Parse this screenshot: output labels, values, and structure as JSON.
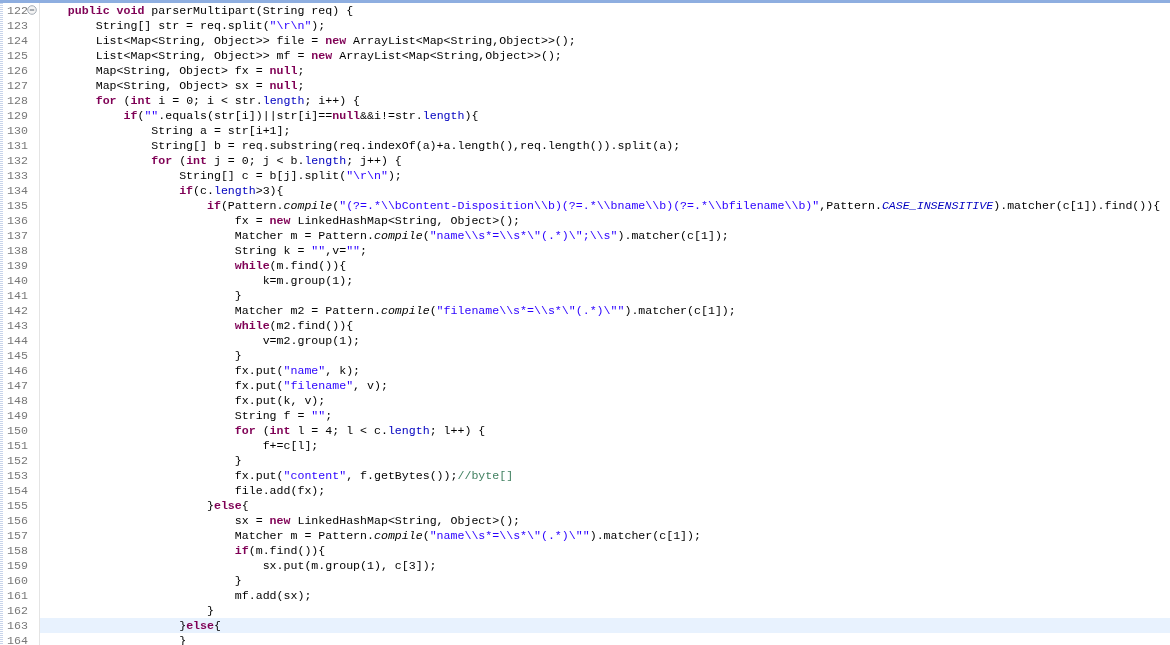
{
  "editor": {
    "lines": [
      {
        "number": "122",
        "collapsible": true,
        "current": false,
        "tokens": [
          {
            "kind": "keyword",
            "text": "    public"
          },
          {
            "kind": "keyword",
            "text": " void"
          },
          {
            "kind": "plain",
            "text": " parserMultipart(String req) {"
          }
        ]
      },
      {
        "number": "123",
        "collapsible": false,
        "current": false,
        "tokens": [
          {
            "kind": "plain",
            "text": "        String[] str = req.split("
          },
          {
            "kind": "string",
            "text": "\"\\r\\n\""
          },
          {
            "kind": "plain",
            "text": ");"
          }
        ]
      },
      {
        "number": "124",
        "collapsible": false,
        "current": false,
        "tokens": [
          {
            "kind": "plain",
            "text": "        List<Map<String, Object>> file = "
          },
          {
            "kind": "keyword",
            "text": "new"
          },
          {
            "kind": "plain",
            "text": " ArrayList<Map<String,Object>>();"
          }
        ]
      },
      {
        "number": "125",
        "collapsible": false,
        "current": false,
        "tokens": [
          {
            "kind": "plain",
            "text": "        List<Map<String, Object>> mf = "
          },
          {
            "kind": "keyword",
            "text": "new"
          },
          {
            "kind": "plain",
            "text": " ArrayList<Map<String,Object>>();"
          }
        ]
      },
      {
        "number": "126",
        "collapsible": false,
        "current": false,
        "tokens": [
          {
            "kind": "plain",
            "text": "        Map<String, Object> fx = "
          },
          {
            "kind": "keyword",
            "text": "null"
          },
          {
            "kind": "plain",
            "text": ";"
          }
        ]
      },
      {
        "number": "127",
        "collapsible": false,
        "current": false,
        "tokens": [
          {
            "kind": "plain",
            "text": "        Map<String, Object> sx = "
          },
          {
            "kind": "keyword",
            "text": "null"
          },
          {
            "kind": "plain",
            "text": ";"
          }
        ]
      },
      {
        "number": "128",
        "collapsible": false,
        "current": false,
        "tokens": [
          {
            "kind": "keyword",
            "text": "        for"
          },
          {
            "kind": "plain",
            "text": " ("
          },
          {
            "kind": "keyword",
            "text": "int"
          },
          {
            "kind": "plain",
            "text": " i = 0; i < str."
          },
          {
            "kind": "field",
            "text": "length"
          },
          {
            "kind": "plain",
            "text": "; i++) {"
          }
        ]
      },
      {
        "number": "129",
        "collapsible": false,
        "current": false,
        "tokens": [
          {
            "kind": "keyword",
            "text": "            if"
          },
          {
            "kind": "plain",
            "text": "("
          },
          {
            "kind": "string",
            "text": "\"\""
          },
          {
            "kind": "plain",
            "text": ".equals(str[i])||str[i]=="
          },
          {
            "kind": "keyword",
            "text": "null"
          },
          {
            "kind": "plain",
            "text": "&&i!=str."
          },
          {
            "kind": "field",
            "text": "length"
          },
          {
            "kind": "plain",
            "text": "){"
          }
        ]
      },
      {
        "number": "130",
        "collapsible": false,
        "current": false,
        "tokens": [
          {
            "kind": "plain",
            "text": "                String a = str[i+1];"
          }
        ]
      },
      {
        "number": "131",
        "collapsible": false,
        "current": false,
        "tokens": [
          {
            "kind": "plain",
            "text": "                String[] b = req.substring(req.indexOf(a)+a.length(),req.length()).split(a);"
          }
        ]
      },
      {
        "number": "132",
        "collapsible": false,
        "current": false,
        "tokens": [
          {
            "kind": "keyword",
            "text": "                for"
          },
          {
            "kind": "plain",
            "text": " ("
          },
          {
            "kind": "keyword",
            "text": "int"
          },
          {
            "kind": "plain",
            "text": " j = 0; j < b."
          },
          {
            "kind": "field",
            "text": "length"
          },
          {
            "kind": "plain",
            "text": "; j++) {"
          }
        ]
      },
      {
        "number": "133",
        "collapsible": false,
        "current": false,
        "tokens": [
          {
            "kind": "plain",
            "text": "                    String[] c = b[j].split("
          },
          {
            "kind": "string",
            "text": "\"\\r\\n\""
          },
          {
            "kind": "plain",
            "text": ");"
          }
        ]
      },
      {
        "number": "134",
        "collapsible": false,
        "current": false,
        "tokens": [
          {
            "kind": "keyword",
            "text": "                    if"
          },
          {
            "kind": "plain",
            "text": "(c."
          },
          {
            "kind": "field",
            "text": "length"
          },
          {
            "kind": "plain",
            "text": ">3){"
          }
        ]
      },
      {
        "number": "135",
        "collapsible": false,
        "current": false,
        "tokens": [
          {
            "kind": "keyword",
            "text": "                        if"
          },
          {
            "kind": "plain",
            "text": "(Pattern."
          },
          {
            "kind": "static",
            "text": "compile"
          },
          {
            "kind": "plain",
            "text": "("
          },
          {
            "kind": "string",
            "text": "\"(?=.*\\\\bContent-Disposition\\\\b)(?=.*\\\\bname\\\\b)(?=.*\\\\bfilename\\\\b)\""
          },
          {
            "kind": "plain",
            "text": ",Pattern."
          },
          {
            "kind": "static_field",
            "text": "CASE_INSENSITIVE"
          },
          {
            "kind": "plain",
            "text": ").matcher(c[1]).find()){"
          }
        ]
      },
      {
        "number": "136",
        "collapsible": false,
        "current": false,
        "tokens": [
          {
            "kind": "plain",
            "text": "                            fx = "
          },
          {
            "kind": "keyword",
            "text": "new"
          },
          {
            "kind": "plain",
            "text": " LinkedHashMap<String, Object>();"
          }
        ]
      },
      {
        "number": "137",
        "collapsible": false,
        "current": false,
        "tokens": [
          {
            "kind": "plain",
            "text": "                            Matcher m = Pattern."
          },
          {
            "kind": "static",
            "text": "compile"
          },
          {
            "kind": "plain",
            "text": "("
          },
          {
            "kind": "string",
            "text": "\"name\\\\s*=\\\\s*\\\"(.*)\\\";\\\\s\""
          },
          {
            "kind": "plain",
            "text": ").matcher(c[1]);"
          }
        ]
      },
      {
        "number": "138",
        "collapsible": false,
        "current": false,
        "tokens": [
          {
            "kind": "plain",
            "text": "                            String k = "
          },
          {
            "kind": "string",
            "text": "\"\""
          },
          {
            "kind": "plain",
            "text": ",v="
          },
          {
            "kind": "string",
            "text": "\"\""
          },
          {
            "kind": "plain",
            "text": ";"
          }
        ]
      },
      {
        "number": "139",
        "collapsible": false,
        "current": false,
        "tokens": [
          {
            "kind": "keyword",
            "text": "                            while"
          },
          {
            "kind": "plain",
            "text": "(m.find()){"
          }
        ]
      },
      {
        "number": "140",
        "collapsible": false,
        "current": false,
        "tokens": [
          {
            "kind": "plain",
            "text": "                                k=m.group(1);"
          }
        ]
      },
      {
        "number": "141",
        "collapsible": false,
        "current": false,
        "tokens": [
          {
            "kind": "plain",
            "text": "                            }"
          }
        ]
      },
      {
        "number": "142",
        "collapsible": false,
        "current": false,
        "tokens": [
          {
            "kind": "plain",
            "text": "                            Matcher m2 = Pattern."
          },
          {
            "kind": "static",
            "text": "compile"
          },
          {
            "kind": "plain",
            "text": "("
          },
          {
            "kind": "string",
            "text": "\"filename\\\\s*=\\\\s*\\\"(.*)\\\"\""
          },
          {
            "kind": "plain",
            "text": ").matcher(c[1]);"
          }
        ]
      },
      {
        "number": "143",
        "collapsible": false,
        "current": false,
        "tokens": [
          {
            "kind": "keyword",
            "text": "                            while"
          },
          {
            "kind": "plain",
            "text": "(m2.find()){"
          }
        ]
      },
      {
        "number": "144",
        "collapsible": false,
        "current": false,
        "tokens": [
          {
            "kind": "plain",
            "text": "                                v=m2.group(1);"
          }
        ]
      },
      {
        "number": "145",
        "collapsible": false,
        "current": false,
        "tokens": [
          {
            "kind": "plain",
            "text": "                            }"
          }
        ]
      },
      {
        "number": "146",
        "collapsible": false,
        "current": false,
        "tokens": [
          {
            "kind": "plain",
            "text": "                            fx.put("
          },
          {
            "kind": "string",
            "text": "\"name\""
          },
          {
            "kind": "plain",
            "text": ", k);"
          }
        ]
      },
      {
        "number": "147",
        "collapsible": false,
        "current": false,
        "tokens": [
          {
            "kind": "plain",
            "text": "                            fx.put("
          },
          {
            "kind": "string",
            "text": "\"filename\""
          },
          {
            "kind": "plain",
            "text": ", v);"
          }
        ]
      },
      {
        "number": "148",
        "collapsible": false,
        "current": false,
        "tokens": [
          {
            "kind": "plain",
            "text": "                            fx.put(k, v);"
          }
        ]
      },
      {
        "number": "149",
        "collapsible": false,
        "current": false,
        "tokens": [
          {
            "kind": "plain",
            "text": "                            String f = "
          },
          {
            "kind": "string",
            "text": "\"\""
          },
          {
            "kind": "plain",
            "text": ";"
          }
        ]
      },
      {
        "number": "150",
        "collapsible": false,
        "current": false,
        "tokens": [
          {
            "kind": "keyword",
            "text": "                            for"
          },
          {
            "kind": "plain",
            "text": " ("
          },
          {
            "kind": "keyword",
            "text": "int"
          },
          {
            "kind": "plain",
            "text": " l = 4; l < c."
          },
          {
            "kind": "field",
            "text": "length"
          },
          {
            "kind": "plain",
            "text": "; l++) {"
          }
        ]
      },
      {
        "number": "151",
        "collapsible": false,
        "current": false,
        "tokens": [
          {
            "kind": "plain",
            "text": "                                f+=c[l];"
          }
        ]
      },
      {
        "number": "152",
        "collapsible": false,
        "current": false,
        "tokens": [
          {
            "kind": "plain",
            "text": "                            }"
          }
        ]
      },
      {
        "number": "153",
        "collapsible": false,
        "current": false,
        "tokens": [
          {
            "kind": "plain",
            "text": "                            fx.put("
          },
          {
            "kind": "string",
            "text": "\"content\""
          },
          {
            "kind": "plain",
            "text": ", f.getBytes());"
          },
          {
            "kind": "comment",
            "text": "//byte[]"
          }
        ]
      },
      {
        "number": "154",
        "collapsible": false,
        "current": false,
        "tokens": [
          {
            "kind": "plain",
            "text": "                            file.add(fx);"
          }
        ]
      },
      {
        "number": "155",
        "collapsible": false,
        "current": false,
        "tokens": [
          {
            "kind": "plain",
            "text": "                        }"
          },
          {
            "kind": "keyword",
            "text": "else"
          },
          {
            "kind": "plain",
            "text": "{"
          }
        ]
      },
      {
        "number": "156",
        "collapsible": false,
        "current": false,
        "tokens": [
          {
            "kind": "plain",
            "text": "                            sx = "
          },
          {
            "kind": "keyword",
            "text": "new"
          },
          {
            "kind": "plain",
            "text": " LinkedHashMap<String, Object>();"
          }
        ]
      },
      {
        "number": "157",
        "collapsible": false,
        "current": false,
        "tokens": [
          {
            "kind": "plain",
            "text": "                            Matcher m = Pattern."
          },
          {
            "kind": "static",
            "text": "compile"
          },
          {
            "kind": "plain",
            "text": "("
          },
          {
            "kind": "string",
            "text": "\"name\\\\s*=\\\\s*\\\"(.*)\\\"\""
          },
          {
            "kind": "plain",
            "text": ").matcher(c[1]);"
          }
        ]
      },
      {
        "number": "158",
        "collapsible": false,
        "current": false,
        "tokens": [
          {
            "kind": "keyword",
            "text": "                            if"
          },
          {
            "kind": "plain",
            "text": "(m.find()){"
          }
        ]
      },
      {
        "number": "159",
        "collapsible": false,
        "current": false,
        "tokens": [
          {
            "kind": "plain",
            "text": "                                sx.put(m.group(1), c[3]);"
          }
        ]
      },
      {
        "number": "160",
        "collapsible": false,
        "current": false,
        "tokens": [
          {
            "kind": "plain",
            "text": "                            }"
          }
        ]
      },
      {
        "number": "161",
        "collapsible": false,
        "current": false,
        "tokens": [
          {
            "kind": "plain",
            "text": "                            mf.add(sx);"
          }
        ]
      },
      {
        "number": "162",
        "collapsible": false,
        "current": false,
        "tokens": [
          {
            "kind": "plain",
            "text": "                        }"
          }
        ]
      },
      {
        "number": "163",
        "collapsible": false,
        "current": true,
        "tokens": [
          {
            "kind": "plain",
            "text": "                    }"
          },
          {
            "kind": "keyword",
            "text": "else"
          },
          {
            "kind": "plain",
            "text": "{"
          }
        ]
      },
      {
        "number": "164",
        "collapsible": false,
        "current": false,
        "tokens": [
          {
            "kind": "plain",
            "text": "                    }"
          }
        ]
      }
    ]
  }
}
